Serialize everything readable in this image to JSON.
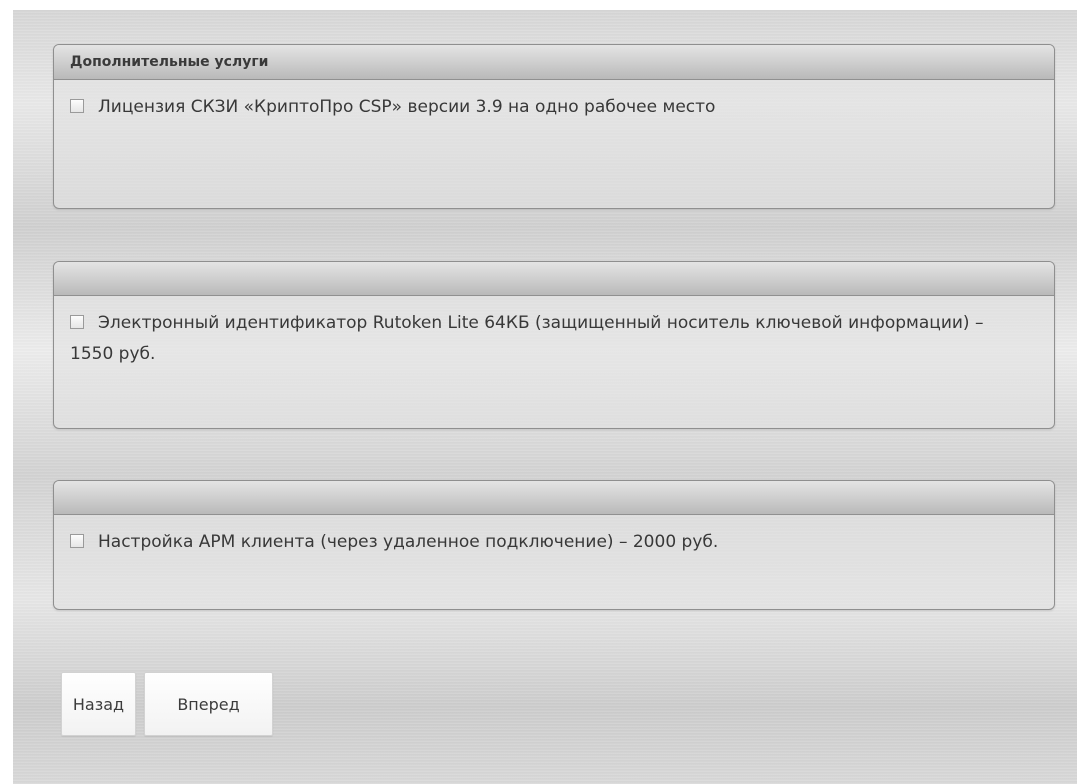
{
  "panels": [
    {
      "heading": "Дополнительные услуги",
      "option_label": "Лицензия СКЗИ «КриптоПро CSP» версии 3.9 на одно рабочее место",
      "checked": false
    },
    {
      "heading": "",
      "option_label": "Электронный идентификатор Rutoken Lite 64КБ (защищенный носитель ключевой информации) – 1550 руб.",
      "checked": false
    },
    {
      "heading": "",
      "option_label": "Настройка АРМ клиента (через удаленное подключение) – 2000 руб.",
      "checked": false
    }
  ],
  "buttons": {
    "back": "Назад",
    "next": "Вперед"
  }
}
